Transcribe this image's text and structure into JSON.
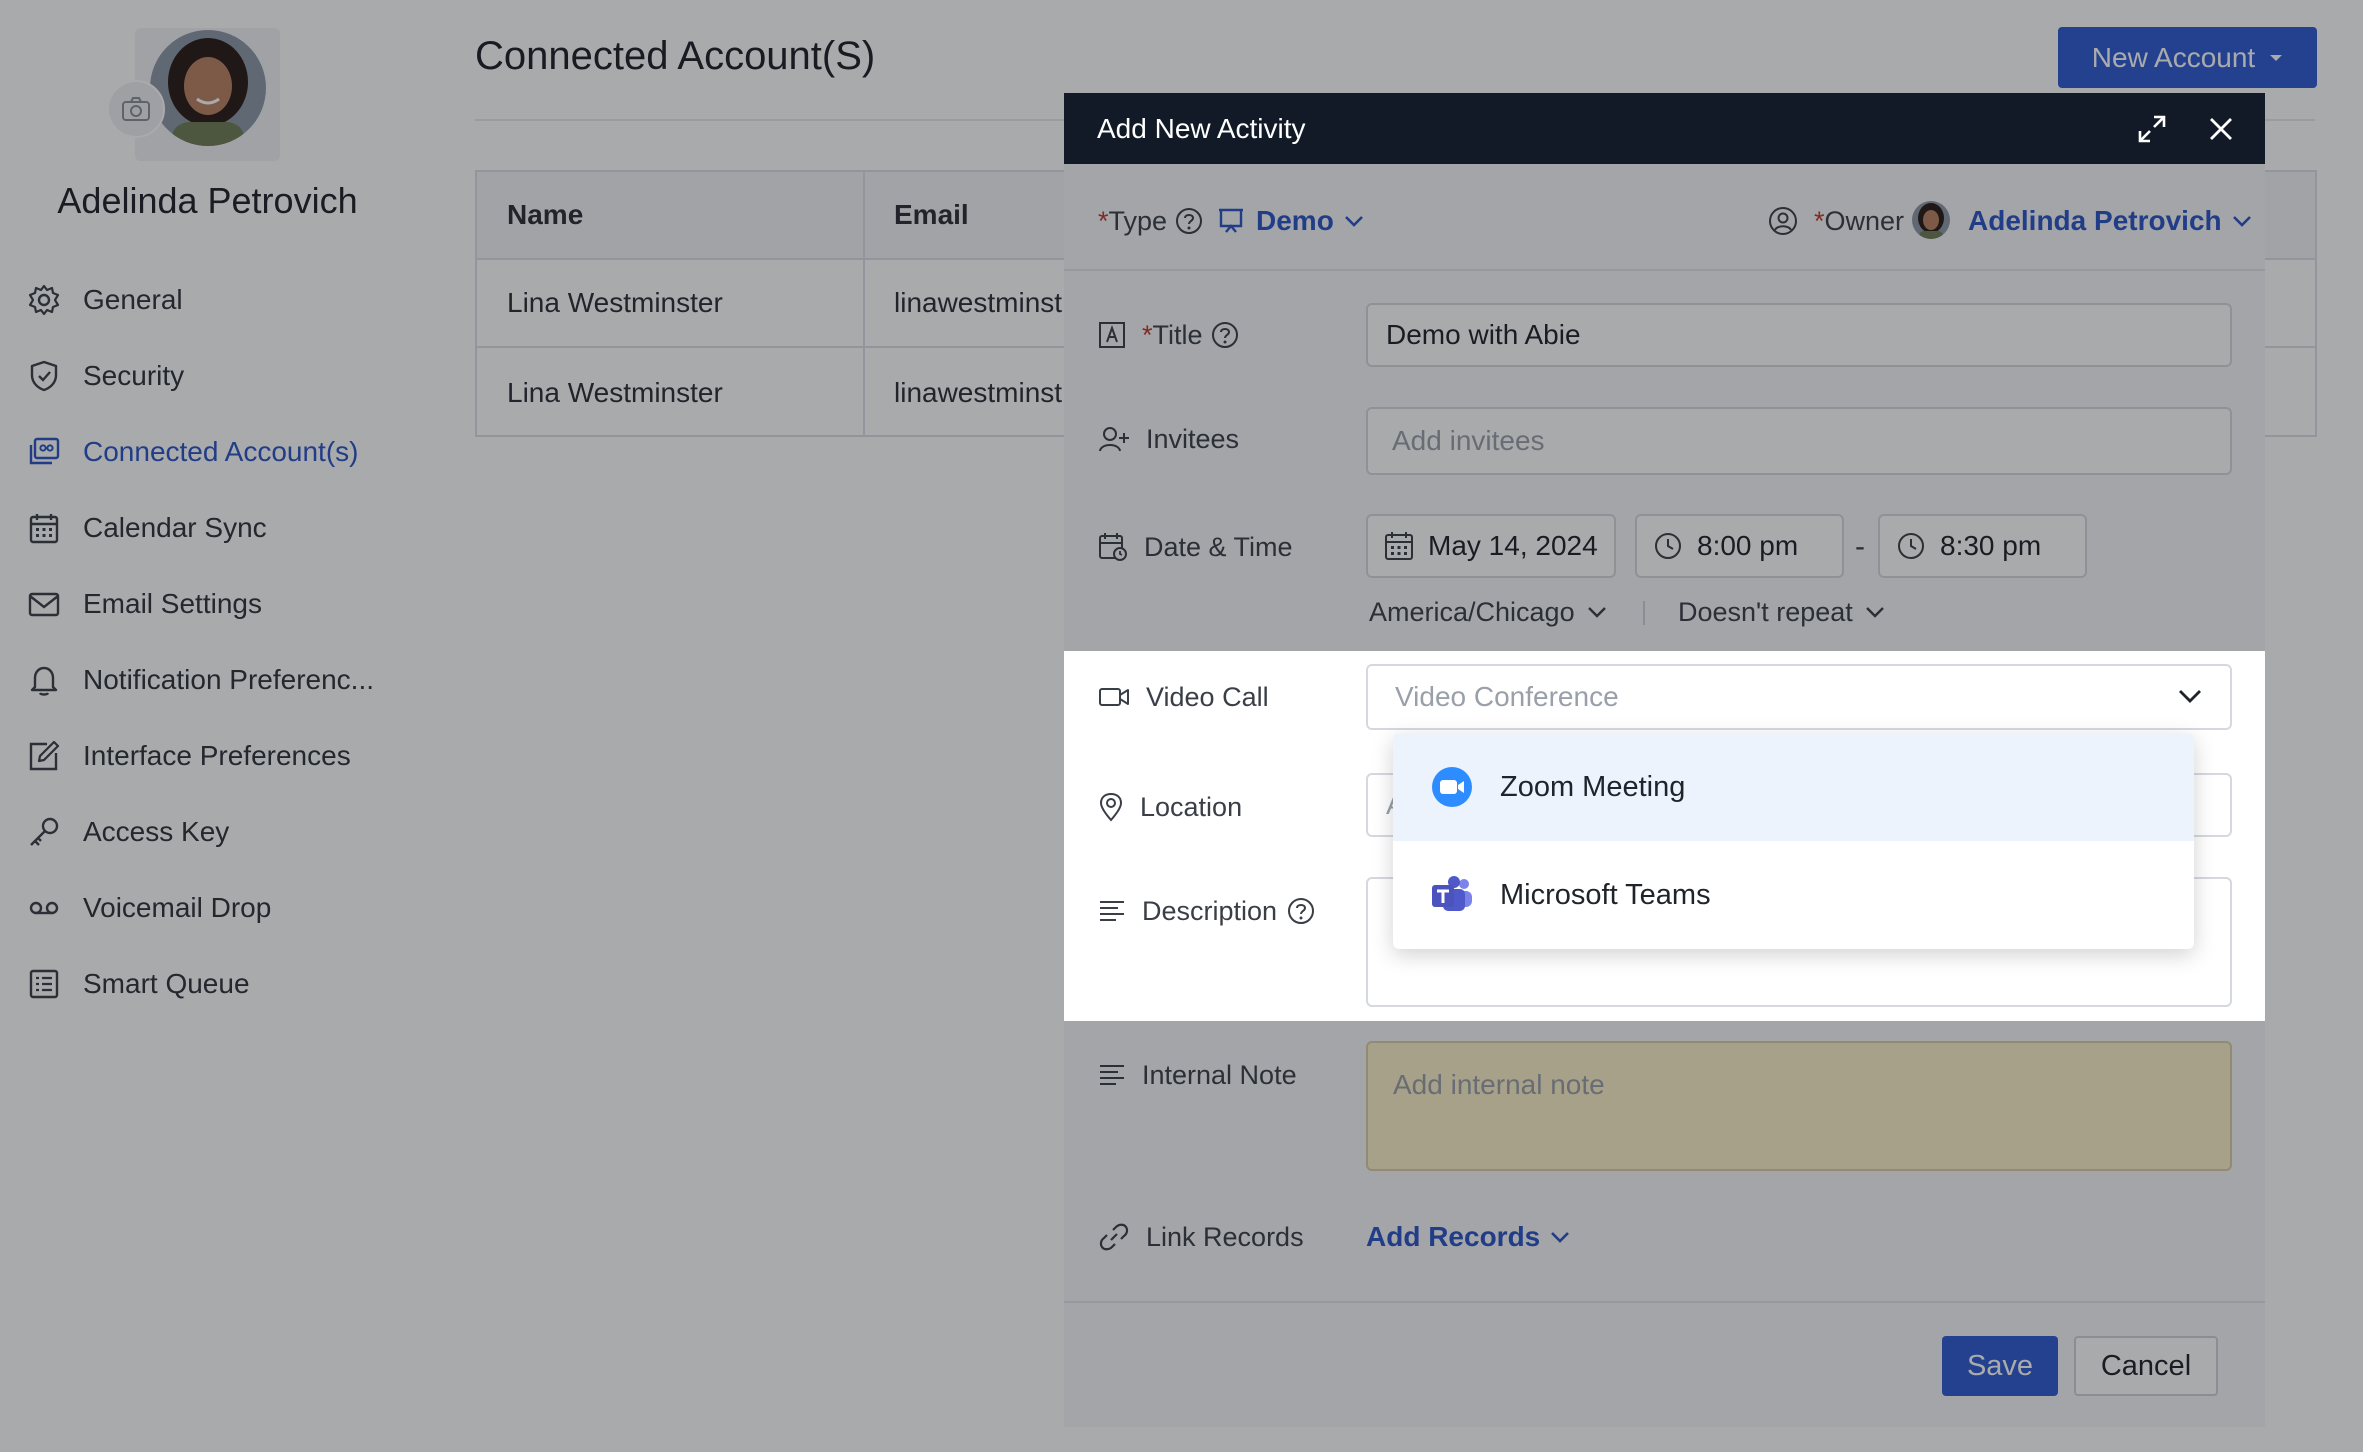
{
  "profile": {
    "name": "Adelinda Petrovich"
  },
  "sidebar": {
    "items": [
      {
        "label": "General",
        "icon": "gear-icon"
      },
      {
        "label": "Security",
        "icon": "shield-icon"
      },
      {
        "label": "Connected Account(s)",
        "icon": "connected-accounts-icon",
        "active": true
      },
      {
        "label": "Calendar Sync",
        "icon": "calendar-icon"
      },
      {
        "label": "Email Settings",
        "icon": "mail-icon"
      },
      {
        "label": "Notification Preferenc...",
        "icon": "bell-icon"
      },
      {
        "label": "Interface Preferences",
        "icon": "edit-window-icon"
      },
      {
        "label": "Access Key",
        "icon": "key-icon"
      },
      {
        "label": "Voicemail Drop",
        "icon": "voicemail-icon"
      },
      {
        "label": "Smart Queue",
        "icon": "list-icon"
      }
    ]
  },
  "main": {
    "title": "Connected Account(S)",
    "new_account_label": "New Account",
    "table": {
      "columns": [
        "Name",
        "Email"
      ],
      "rows": [
        {
          "name": "Lina Westminster",
          "email": "linawestminst"
        },
        {
          "name": "Lina Westminster",
          "email": "linawestminst"
        }
      ]
    }
  },
  "modal": {
    "title": "Add New Activity",
    "type_label": "Type",
    "type_value": "Demo",
    "owner_label": "Owner",
    "owner_value": "Adelinda Petrovich",
    "title_label": "Title",
    "title_value": "Demo with Abie",
    "invitees_label": "Invitees",
    "invitees_placeholder": "Add invitees",
    "datetime_label": "Date & Time",
    "date_value": "May 14, 2024",
    "start_time": "8:00 pm",
    "time_separator": "-",
    "end_time": "8:30 pm",
    "timezone": "America/Chicago",
    "repeat": "Doesn't repeat",
    "video_call_label": "Video Call",
    "video_call_placeholder": "Video Conference",
    "video_options": [
      {
        "label": "Zoom Meeting",
        "icon": "zoom-icon"
      },
      {
        "label": "Microsoft Teams",
        "icon": "teams-icon"
      }
    ],
    "location_label": "Location",
    "location_placeholder_fragment": "A",
    "description_label": "Description",
    "internal_note_label": "Internal Note",
    "internal_note_placeholder": "Add internal note",
    "link_records_label": "Link Records",
    "add_records_label": "Add Records",
    "save_label": "Save",
    "cancel_label": "Cancel"
  },
  "colors": {
    "accent": "#2f5bd3",
    "link": "#2c55c6",
    "modal_header": "#121a27",
    "required": "#c0392b",
    "highlight": "#edf3fc",
    "internal_note_bg": "#fdf1c8"
  }
}
